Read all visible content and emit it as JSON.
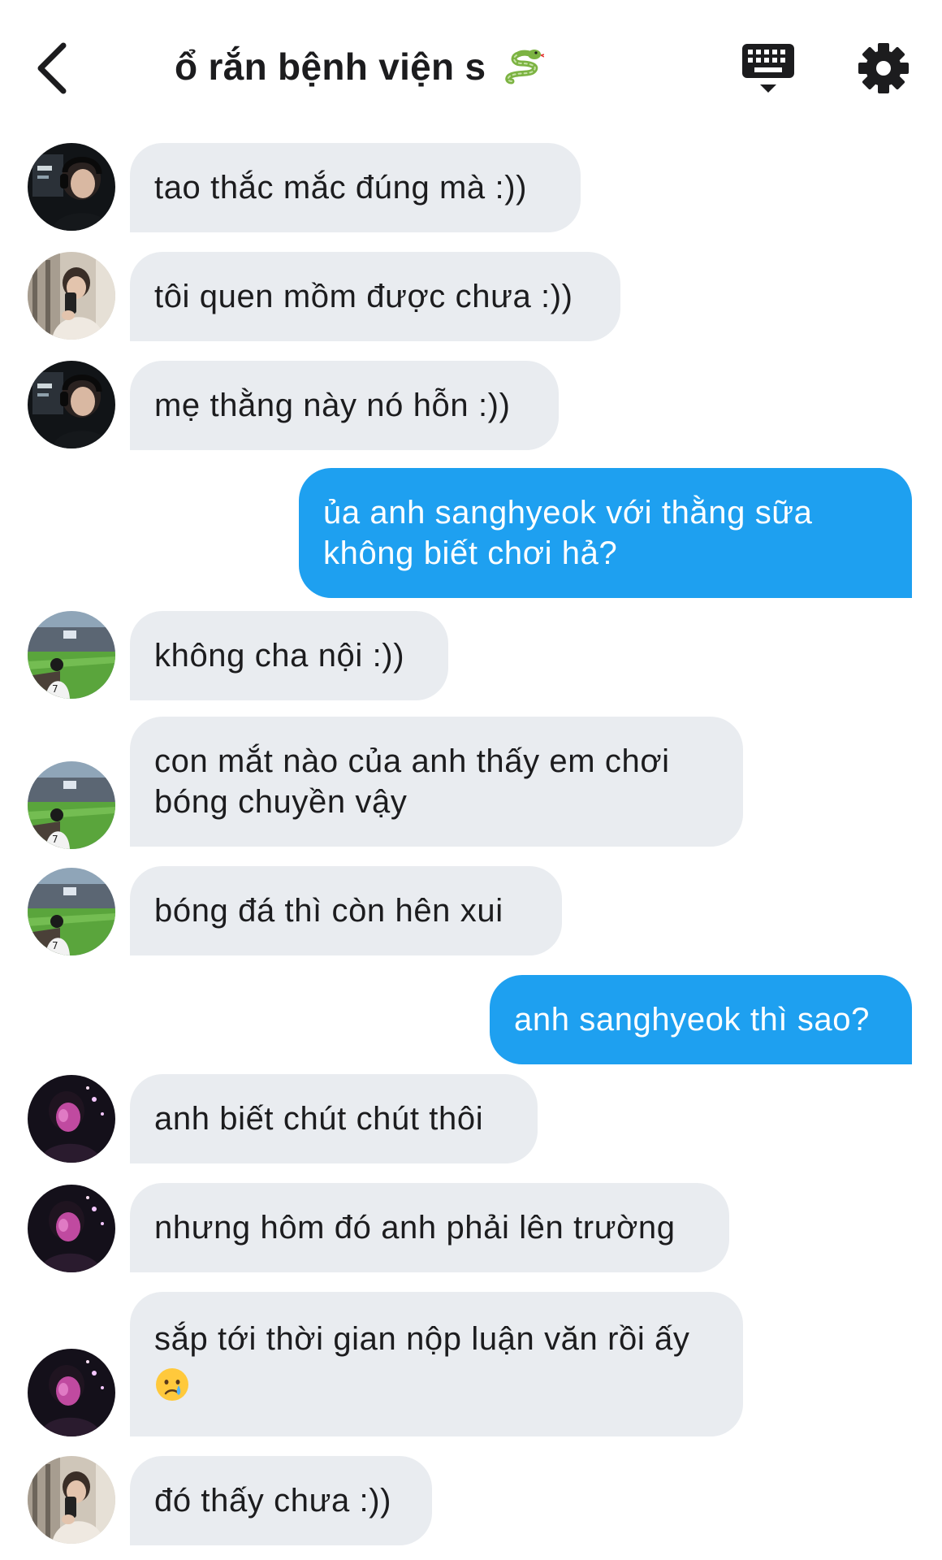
{
  "header": {
    "title": "ổ rắn bệnh viện s",
    "title_emoji": "snake-emoji",
    "back_icon": "chevron-left-icon",
    "keyboard_icon": "keyboard-icon",
    "settings_icon": "gear-icon"
  },
  "colors": {
    "incoming_bubble": "#e9ecf0",
    "outgoing_bubble": "#1ea0f0",
    "outgoing_text": "#ffffff",
    "incoming_text": "#1c1c1e"
  },
  "messages": [
    {
      "side": "incoming",
      "avatar": "gamer-headset",
      "lines": [
        "tao thắc mắc đúng mà :))"
      ]
    },
    {
      "side": "incoming",
      "avatar": "mirror-selfie",
      "lines": [
        "tôi quen mồm được chưa :))"
      ]
    },
    {
      "side": "incoming",
      "avatar": "gamer-headset",
      "lines": [
        "mẹ thằng này nó hỗn :))"
      ]
    },
    {
      "side": "outgoing",
      "lines": [
        "ủa anh sanghyeok với thằng sữa",
        "không biết chơi hả?"
      ]
    },
    {
      "side": "incoming",
      "avatar": "stadium",
      "lines": [
        "không cha nội :))"
      ]
    },
    {
      "side": "incoming",
      "avatar": "stadium",
      "lines": [
        "con mắt nào của anh thấy em chơi",
        "bóng chuyền vậy"
      ]
    },
    {
      "side": "incoming",
      "avatar": "stadium",
      "lines": [
        "bóng đá thì còn hên xui"
      ]
    },
    {
      "side": "outgoing",
      "lines": [
        "anh sanghyeok thì sao?"
      ]
    },
    {
      "side": "incoming",
      "avatar": "pink-night",
      "lines": [
        "anh biết chút chút thôi"
      ]
    },
    {
      "side": "incoming",
      "avatar": "pink-night",
      "lines": [
        "nhưng hôm đó anh phải lên trường"
      ]
    },
    {
      "side": "incoming",
      "avatar": "pink-night",
      "lines": [
        "sắp tới thời gian nộp luận văn rồi ấy"
      ],
      "emoji": "crying-face-emoji"
    },
    {
      "side": "incoming",
      "avatar": "mirror-selfie",
      "lines": [
        "đó thấy chưa :))"
      ]
    }
  ]
}
